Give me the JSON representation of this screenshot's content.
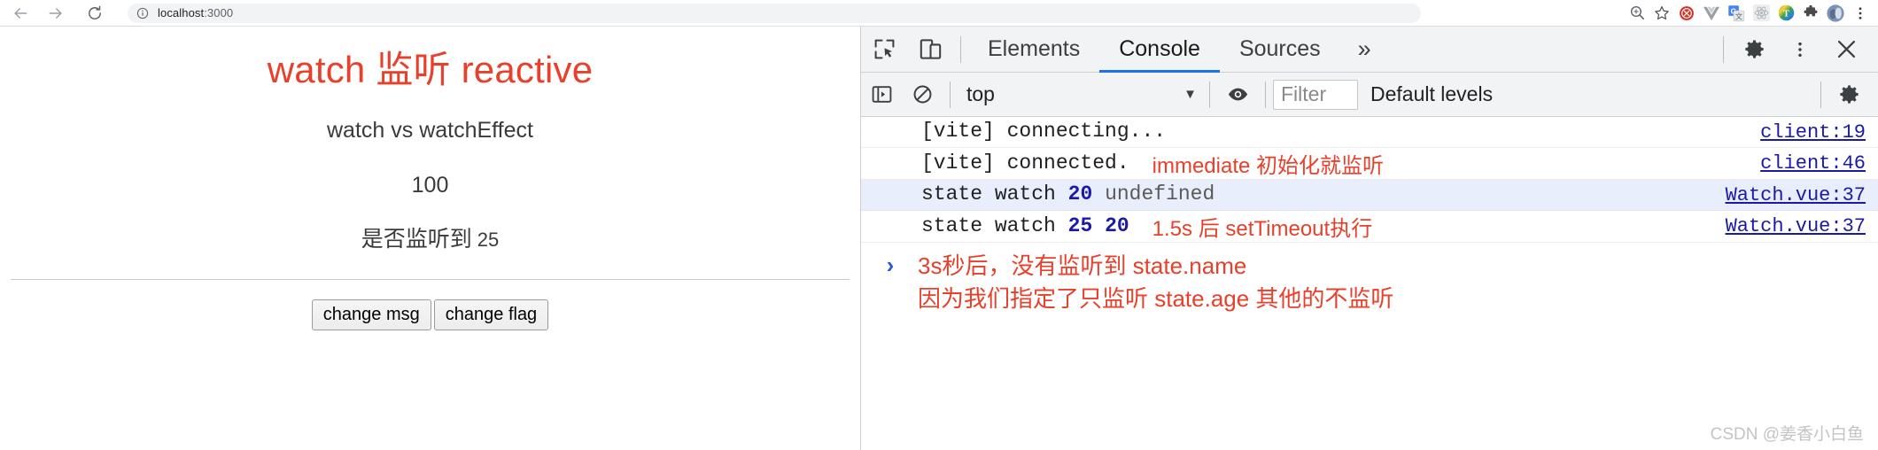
{
  "browser": {
    "back_label": "Back",
    "forward_label": "Forward",
    "reload_label": "Reload",
    "omnibox": {
      "info_icon": "info-circle-icon",
      "host": "localhost",
      "port": ":3000",
      "full_url": "localhost:3000"
    },
    "actions": [
      {
        "name": "zoom-icon",
        "label": "Zoom"
      },
      {
        "name": "bookmark-star-icon",
        "label": "Bookmark this tab"
      },
      {
        "name": "extension-red-icon",
        "label": "Extension"
      },
      {
        "name": "vue-devtools-icon",
        "label": "Vue.js devtools"
      },
      {
        "name": "google-translate-icon",
        "label": "Google Translate"
      },
      {
        "name": "react-devtools-icon",
        "label": "React Developer Tools"
      },
      {
        "name": "color-picker-icon",
        "label": "Color picker"
      },
      {
        "name": "puzzle-extensions-icon",
        "label": "Extensions"
      },
      {
        "name": "profile-avatar-icon",
        "label": "Profile"
      },
      {
        "name": "chrome-menu-icon",
        "label": "Customize and control Google Chrome"
      }
    ]
  },
  "page": {
    "title": "watch 监听 reactive",
    "subtitle": "watch vs watchEffect",
    "count": "100",
    "watch_label": "是否监听到",
    "watch_value": "25",
    "buttons": [
      {
        "name": "change-msg-button",
        "label": "change msg"
      },
      {
        "name": "change-flag-button",
        "label": "change flag"
      }
    ]
  },
  "devtools": {
    "inspect_icon": "inspect-element-icon",
    "device_icon": "toggle-device-toolbar-icon",
    "tabs": [
      {
        "name": "tab-elements",
        "label": "Elements",
        "active": false
      },
      {
        "name": "tab-console",
        "label": "Console",
        "active": true
      },
      {
        "name": "tab-sources",
        "label": "Sources",
        "active": false
      }
    ],
    "more_tabs_label": "»",
    "settings_icon": "gear-icon",
    "kebab_icon": "more-options-icon",
    "close_icon": "close-icon",
    "console_toolbar": {
      "sidebar_icon": "console-sidebar-icon",
      "clear_icon": "clear-console-icon",
      "context": "top",
      "context_caret": "▼",
      "eye_icon": "live-expression-eye-icon",
      "filter_placeholder": "Filter",
      "levels": "Default levels",
      "settings_icon": "console-settings-gear-icon"
    },
    "messages": [
      {
        "name": "console-message-vite-connecting",
        "text": "[vite] connecting...",
        "annotation": "",
        "source": "client:19",
        "highlight": false
      },
      {
        "name": "console-message-vite-connected",
        "text": "[vite] connected.",
        "annotation": "immediate 初始化就监听",
        "source": "client:46",
        "highlight": false
      },
      {
        "name": "console-message-state-watch-1",
        "text_prefix": "state watch ",
        "num1": "20",
        "text_mid": " ",
        "undefined_text": "undefined",
        "annotation": "",
        "source": "Watch.vue:37",
        "highlight": true
      },
      {
        "name": "console-message-state-watch-2",
        "text_prefix": "state watch ",
        "num1": "25",
        "text_mid": " ",
        "num2": "20",
        "annotation": "1.5s 后 setTimeout执行",
        "source": "Watch.vue:37",
        "highlight": false
      }
    ],
    "prompt": {
      "chevron": "›",
      "annotation_line1": "3s秒后，没有监听到 state.name",
      "annotation_line2": "因为我们指定了只监听 state.age 其他的不监听"
    }
  },
  "watermark": "CSDN @姜香小白鱼",
  "colors": {
    "accent_red": "#e8402a",
    "console_link_blue": "#1a1aa6",
    "tab_active_blue": "#1a73e8",
    "highlight_row": "#e8eefb"
  }
}
